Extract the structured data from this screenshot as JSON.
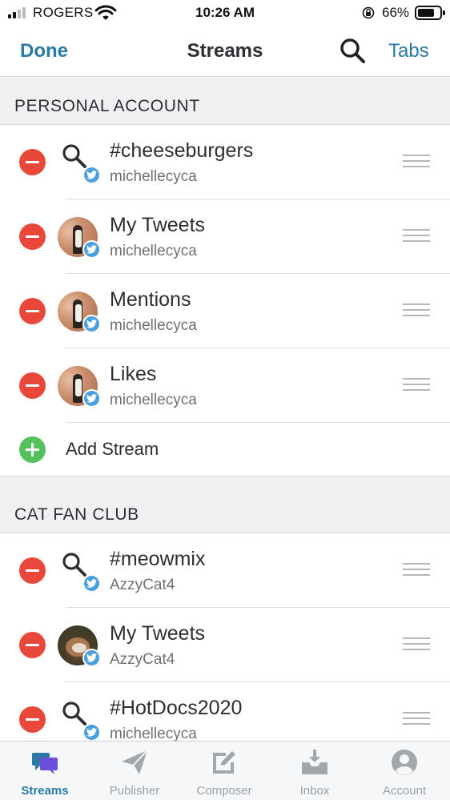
{
  "status_bar": {
    "carrier": "ROGERS",
    "time": "10:26 AM",
    "battery_percent": "66%",
    "battery_level": 0.66,
    "icons": [
      "signal-icon",
      "wifi-icon",
      "orientation-lock-icon",
      "battery-icon"
    ]
  },
  "nav": {
    "done_label": "Done",
    "title": "Streams",
    "search_icon": "search-icon",
    "tabs_label": "Tabs"
  },
  "sections": [
    {
      "title": "PERSONAL ACCOUNT",
      "streams": [
        {
          "name": "#cheeseburgers",
          "user": "michellecyca",
          "icon": "search-icon"
        },
        {
          "name": "My Tweets",
          "user": "michellecyca",
          "icon": "avatar"
        },
        {
          "name": "Mentions",
          "user": "michellecyca",
          "icon": "avatar"
        },
        {
          "name": "Likes",
          "user": "michellecyca",
          "icon": "avatar"
        }
      ],
      "add_label": "Add Stream"
    },
    {
      "title": "CAT FAN CLUB",
      "streams": [
        {
          "name": "#meowmix",
          "user": "AzzyCat4",
          "icon": "search-icon"
        },
        {
          "name": "My Tweets",
          "user": "AzzyCat4",
          "icon": "avatar"
        },
        {
          "name": "#HotDocs2020",
          "user": "michellecyca",
          "icon": "search-icon"
        }
      ]
    }
  ],
  "tab_bar": [
    {
      "label": "Streams",
      "icon": "streams-icon",
      "active": true
    },
    {
      "label": "Publisher",
      "icon": "paper-plane-icon",
      "active": false
    },
    {
      "label": "Composer",
      "icon": "compose-icon",
      "active": false
    },
    {
      "label": "Inbox",
      "icon": "inbox-icon",
      "active": false
    },
    {
      "label": "Account",
      "icon": "account-icon",
      "active": false
    }
  ],
  "colors": {
    "accent": "#2a79a6",
    "remove": "#e8473a",
    "add": "#55c15a",
    "twitter": "#4a9fdf"
  }
}
